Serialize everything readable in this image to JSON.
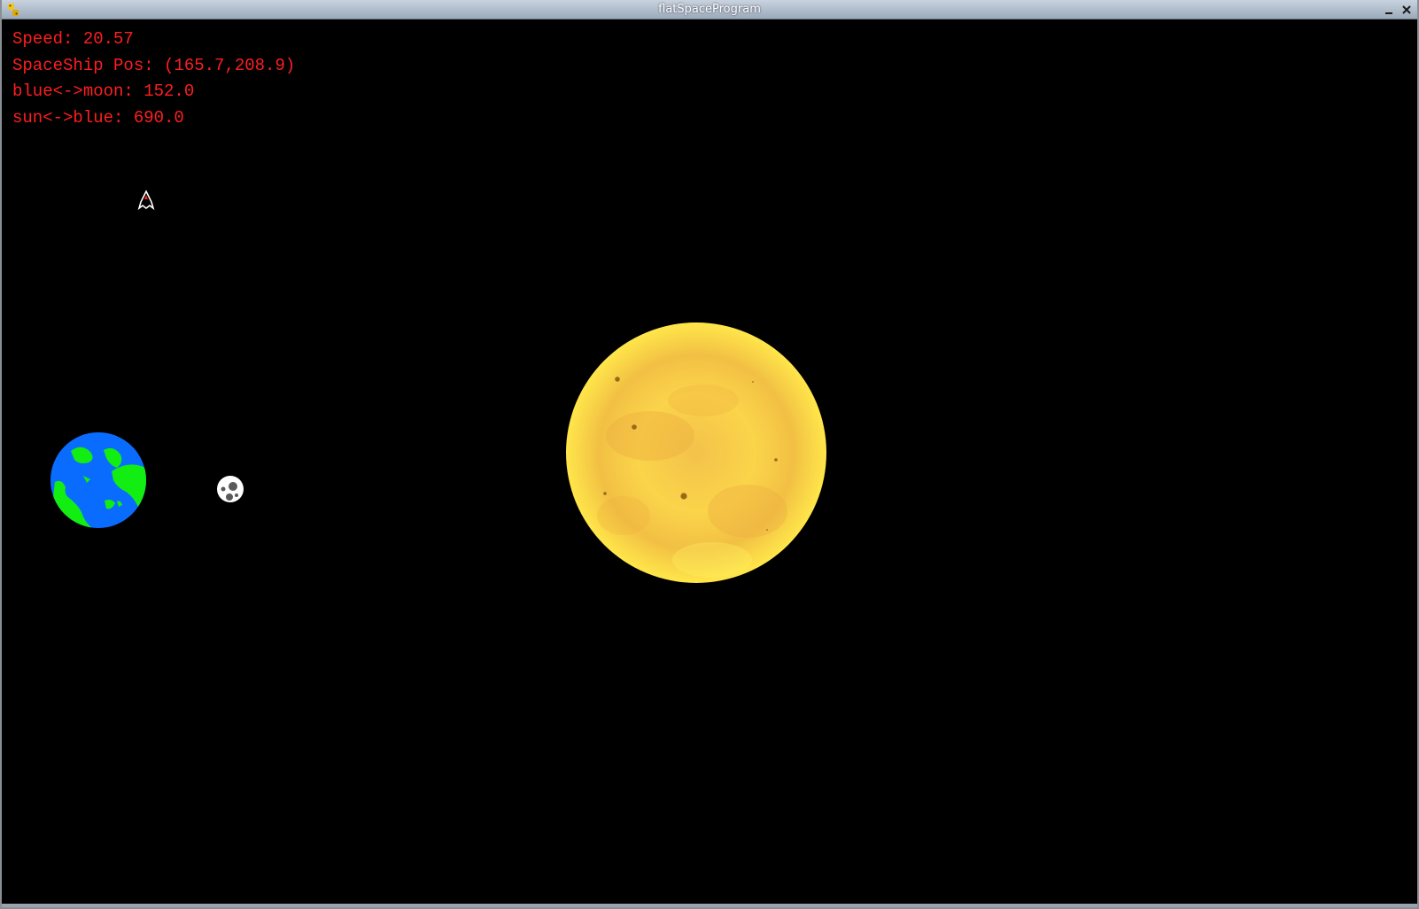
{
  "window": {
    "title": "flatSpaceProgram",
    "app_icon": "python-icon",
    "minimize_icon": "minimize-icon",
    "close_icon": "close-icon"
  },
  "hud": {
    "speed": "Speed: 20.57",
    "ship_pos": "SpaceShip Pos: (165.7,208.9)",
    "blue_moon": "blue<->moon: 152.0",
    "sun_blue": "sun<->blue: 690.0",
    "color": "#ff1e1e"
  },
  "scene": {
    "background": "#000000",
    "planet_blue": {
      "ocean": "#0a6cff",
      "land": "#12ee12"
    },
    "moon": {
      "surface": "#ffffff",
      "crater": "#5a5a5a"
    },
    "sun": {
      "light": "#ffe84a",
      "dark": "#f0b43c",
      "spot": "#9a6a18"
    },
    "ship": {
      "outline": "#ffffff",
      "accent": "#ff2020"
    }
  }
}
